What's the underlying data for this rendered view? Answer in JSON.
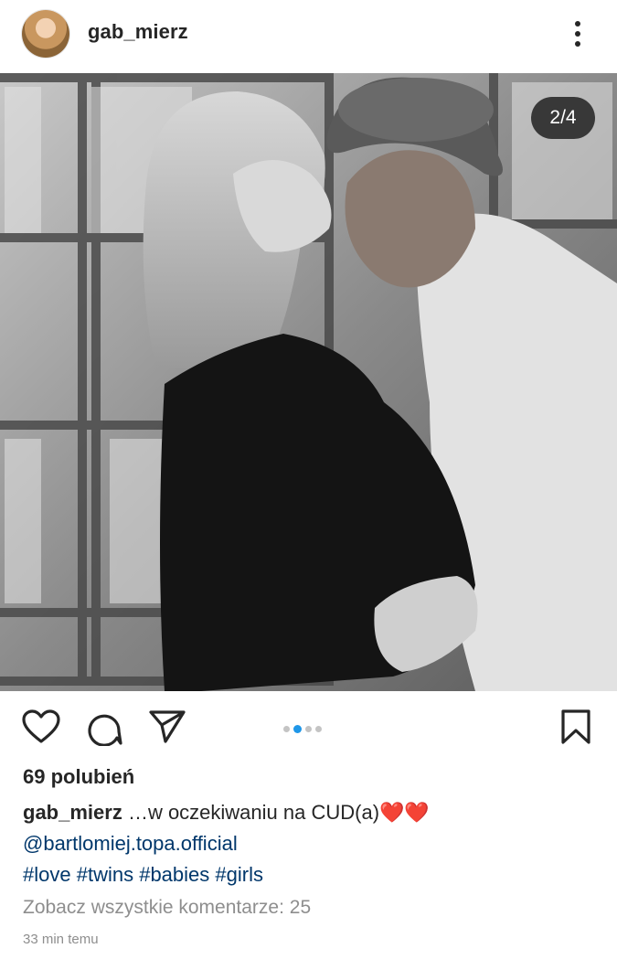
{
  "post": {
    "username": "gab_mierz",
    "slide_counter": "2/4",
    "carousel": {
      "count": 4,
      "active": 2
    },
    "likes": "69 polubień",
    "caption": {
      "username": "gab_mierz",
      "text": " …w oczekiwaniu na CUD(a)",
      "emoji": "❤️❤️",
      "mention": "@bartlomiej.topa.official",
      "hashtags": [
        "#love",
        "#twins",
        "#babies",
        "#girls"
      ]
    },
    "view_comments": "Zobacz wszystkie komentarze: 25",
    "timestamp": "33 min temu"
  },
  "icons": {
    "more": "more-vertical-icon",
    "like": "heart-icon",
    "comment": "comment-icon",
    "share": "send-icon",
    "save": "bookmark-icon"
  },
  "colors": {
    "link": "#00376b",
    "carousel_active": "#1f97e8",
    "muted": "#8e8e8e"
  }
}
